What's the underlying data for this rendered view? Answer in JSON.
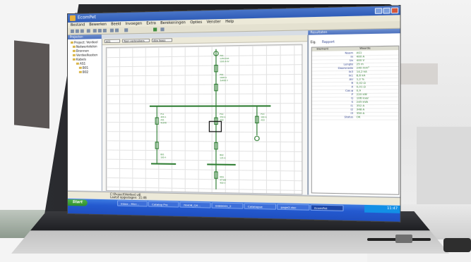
{
  "window": {
    "title": "EcomPet",
    "menu": [
      "Bestand",
      "Bewerken",
      "Beeld",
      "Invoegen",
      "Extra",
      "Berekeningen",
      "Opties",
      "Venster",
      "Help"
    ]
  },
  "panels": {
    "project_header": "Projecten",
    "results_header": "Resultaten"
  },
  "project_tree": [
    "Project: Verdeel",
    "Netwerkdelen",
    "Bronnen",
    "Verdeelkasten",
    "Kabels",
    "AS1",
    "B01",
    "B02"
  ],
  "document": {
    "selectors": [
      "AS1",
      "Toon verbruikers",
      "Alle fases"
    ]
  },
  "results": {
    "tabs": [
      "Eig.",
      "Rapport"
    ],
    "columns": [
      "Element",
      "Waarde"
    ],
    "rows": [
      {
        "label": "Naam",
        "value": "AS1"
      },
      {
        "label": "In",
        "value": "400 A"
      },
      {
        "label": "Un",
        "value": "400 V"
      },
      {
        "label": "Lengte",
        "value": "25 m"
      },
      {
        "label": "Doorsnede",
        "value": "240 mm²"
      },
      {
        "label": "Ik3",
        "value": "14,2 kA"
      },
      {
        "label": "Ik1",
        "value": "8,6 kA"
      },
      {
        "label": "ΔU",
        "value": "1,2 %"
      },
      {
        "label": "R",
        "value": "0,02 Ω"
      },
      {
        "label": "X",
        "value": "0,01 Ω"
      },
      {
        "label": "Cos φ",
        "value": "0,9"
      },
      {
        "label": "P",
        "value": "220 kW"
      },
      {
        "label": "Q",
        "value": "106 kvar"
      },
      {
        "label": "S",
        "value": "245 kVA"
      },
      {
        "label": "I1",
        "value": "352 A"
      },
      {
        "label": "I2",
        "value": "348 A"
      },
      {
        "label": "I3",
        "value": "350 A"
      },
      {
        "label": "Status",
        "value": "OK"
      }
    ]
  },
  "status": {
    "path": "C:\\Project\\Verdeel.vdl",
    "saved": "Laatst opgeslagen: 11:46"
  },
  "taskbar": {
    "start_label": "Start",
    "items": [
      "Inbox - Micr...",
      "Catalog Pro",
      "7640B_QX...",
      "0480001_2",
      "Catalogue",
      "page2.doc",
      "EcomPet"
    ],
    "clock": "11:47"
  }
}
